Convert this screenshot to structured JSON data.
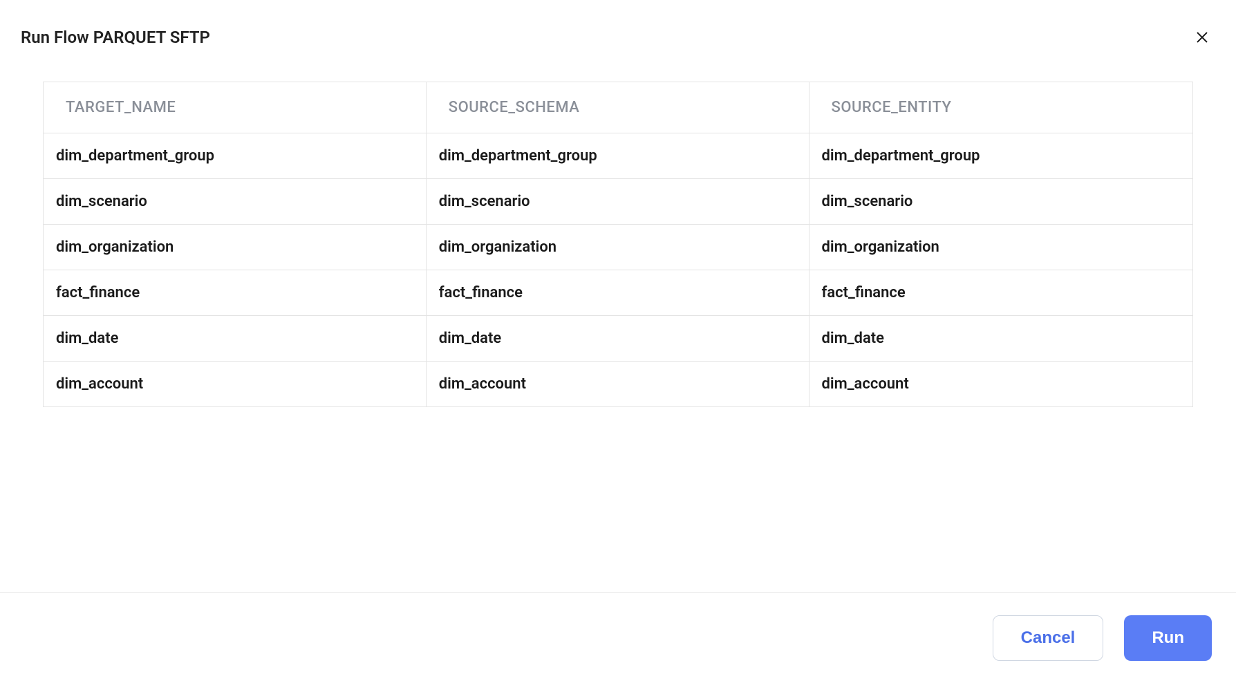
{
  "header": {
    "title": "Run Flow PARQUET SFTP"
  },
  "table": {
    "columns": [
      "TARGET_NAME",
      "SOURCE_SCHEMA",
      "SOURCE_ENTITY"
    ],
    "rows": [
      {
        "target_name": "dim_department_group",
        "source_schema": "dim_department_group",
        "source_entity": "dim_department_group"
      },
      {
        "target_name": "dim_scenario",
        "source_schema": "dim_scenario",
        "source_entity": "dim_scenario"
      },
      {
        "target_name": "dim_organization",
        "source_schema": "dim_organization",
        "source_entity": "dim_organization"
      },
      {
        "target_name": "fact_finance",
        "source_schema": "fact_finance",
        "source_entity": "fact_finance"
      },
      {
        "target_name": "dim_date",
        "source_schema": "dim_date",
        "source_entity": "dim_date"
      },
      {
        "target_name": "dim_account",
        "source_schema": "dim_account",
        "source_entity": "dim_account"
      }
    ]
  },
  "footer": {
    "cancel_label": "Cancel",
    "run_label": "Run"
  }
}
